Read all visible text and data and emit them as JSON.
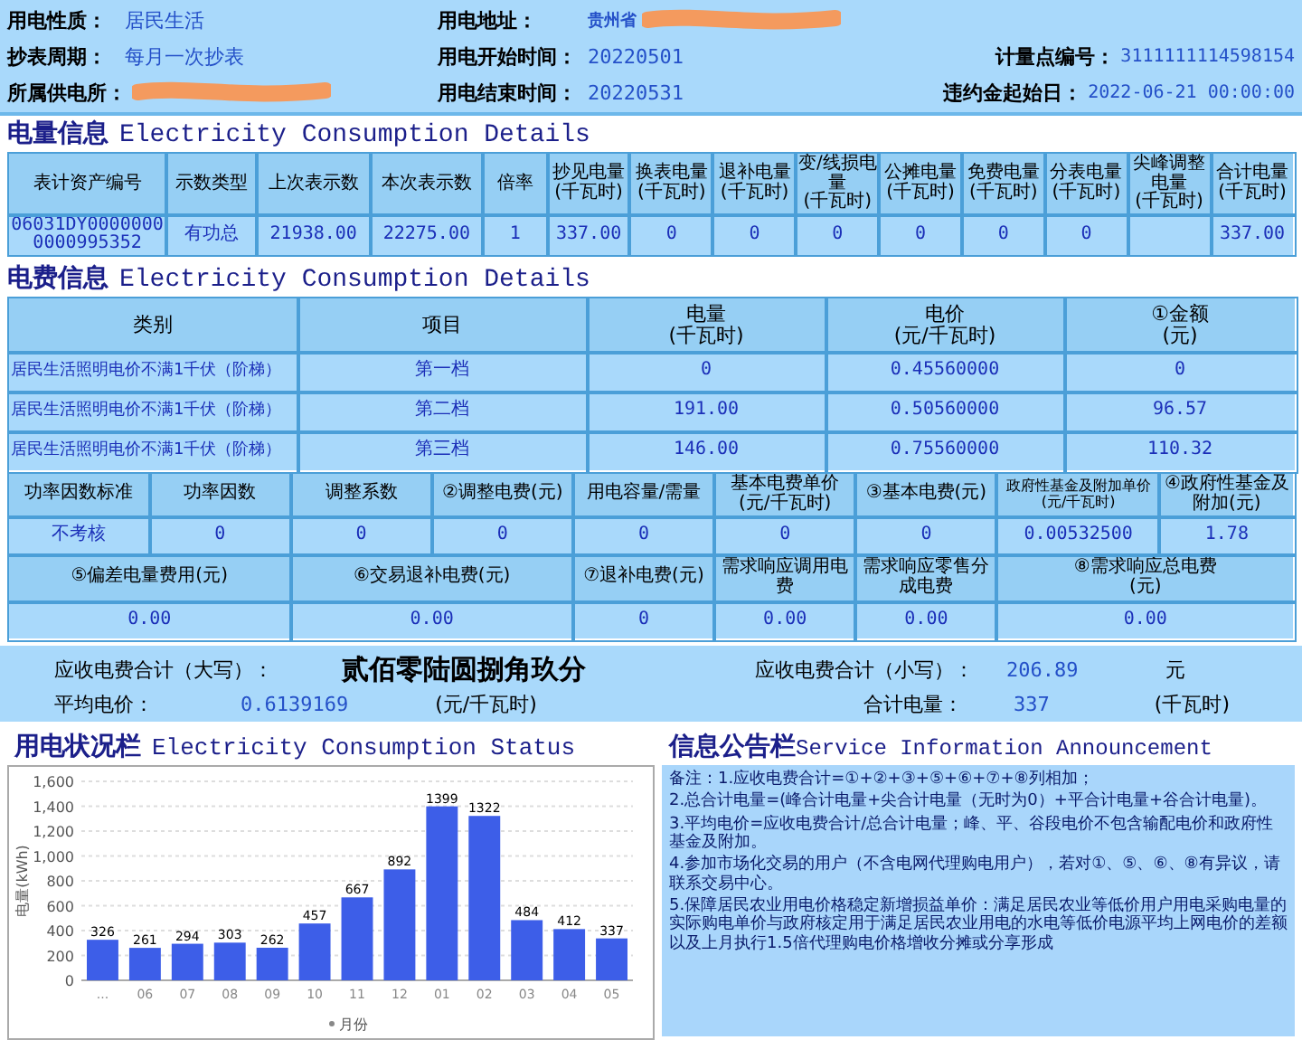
{
  "account_info": [
    [
      {
        "label": "用电性质：",
        "value": "居民生活"
      },
      {
        "label": "用电地址：",
        "value": "贵州省",
        "redacted": true
      }
    ],
    [
      {
        "label": "抄表周期：",
        "value": "每月一次抄表"
      },
      {
        "label": "用电开始时间：",
        "value": "20220501"
      },
      {
        "label": "计量点编号：",
        "value": "3111111114598154"
      }
    ],
    [
      {
        "label": "所属供电所：",
        "redacted": true
      },
      {
        "label": "用电结束时间：",
        "value": "20220531"
      },
      {
        "label": "违约金起始日：",
        "value": "2022-06-21 00:00:00"
      }
    ]
  ],
  "consumption": {
    "title": "电量信息",
    "title_en": "Electricity Consumption Details",
    "columns": [
      "表计资产编号",
      "示数类型",
      "上次表示数",
      "本次表示数",
      "倍率",
      "抄见电量\n(千瓦时)",
      "换表电量\n(千瓦时)",
      "退补电量\n(千瓦时)",
      "变/线损电量\n(千瓦时)",
      "公摊电量\n(千瓦时)",
      "免费电量\n(千瓦时)",
      "分表电量\n(千瓦时)",
      "尖峰调整电量\n(千瓦时)",
      "合计电量\n(千瓦时)"
    ],
    "rows": [
      [
        "06031DY00000000000995352",
        "有功总",
        "21938.00",
        "22275.00",
        "1",
        "337.00",
        "0",
        "0",
        "0",
        "0",
        "0",
        "0",
        "",
        "337.00"
      ]
    ]
  },
  "charges": {
    "title": "电费信息",
    "title_en": "Electricity Consumption Details",
    "columns": [
      "类别",
      "项目",
      "电量\n(千瓦时)",
      "电价\n(元/千瓦时)",
      "①金额\n(元)"
    ],
    "rows": [
      [
        "居民生活照明电价不满1千伏（阶梯）",
        "第一档",
        "0",
        "0.45560000",
        "0"
      ],
      [
        "居民生活照明电价不满1千伏（阶梯）",
        "第二档",
        "191.00",
        "0.50560000",
        "96.57"
      ],
      [
        "居民生活照明电价不满1千伏（阶梯）",
        "第三档",
        "146.00",
        "0.75560000",
        "110.32"
      ]
    ]
  },
  "adjustments": {
    "columns": [
      "功率因数标准",
      "功率因数",
      "调整系数",
      "②调整电费(元)",
      "用电容量/需量",
      "基本电费单价\n(元/千瓦时)",
      "③基本电费(元)",
      "政府性基金及附加单价\n(元/千瓦时)",
      "④政府性基金及附加(元)"
    ],
    "values": [
      "不考核",
      "0",
      "0",
      "0",
      "0",
      "0",
      "0",
      "0.00532500",
      "1.78"
    ]
  },
  "other_fees": {
    "columns": [
      "⑤偏差电量费用(元)",
      "⑥交易退补电费(元)",
      "⑦退补电费(元)",
      "需求响应调用电费",
      "需求响应零售分成电费",
      "⑧需求响应总电费\n(元)"
    ],
    "values": [
      "0.00",
      "0.00",
      "0",
      "0.00",
      "0.00",
      "0.00"
    ]
  },
  "totals": {
    "upper_label": "应收电费合计（大写）：",
    "upper_value": "贰佰零陆圆捌角玖分",
    "lower_label": "应收电费合计（小写）：",
    "lower_value": "206.89",
    "lower_unit": "元",
    "avg_label": "平均电价：",
    "avg_value": "0.6139169",
    "avg_unit": "(元/千瓦时)",
    "kwh_label": "合计电量：",
    "kwh_value": "337",
    "kwh_unit": "(千瓦时)"
  },
  "status": {
    "title": "用电状况栏",
    "title_en": "Electricity Consumption Status",
    "chart_data": {
      "type": "bar",
      "xlabel": "月份",
      "ylabel": "电量(kWh)",
      "categories": [
        "...",
        "06",
        "07",
        "08",
        "09",
        "10",
        "11",
        "12",
        "01",
        "02",
        "03",
        "04",
        "05"
      ],
      "series": [
        {
          "color": "#3d5ee8",
          "values": [
            326,
            261,
            294,
            303,
            262,
            457,
            667,
            892,
            1399,
            1322,
            484,
            412,
            337
          ]
        }
      ],
      "ylim": [
        0,
        1600
      ],
      "yticks": [
        {
          "value": 0,
          "label": "0"
        },
        {
          "value": 200,
          "label": "200"
        },
        {
          "value": 400,
          "label": "400"
        },
        {
          "value": 600,
          "label": "600"
        },
        {
          "value": 800,
          "label": "800"
        },
        {
          "value": 1000,
          "label": "1,000"
        },
        {
          "value": 1200,
          "label": "1,200"
        },
        {
          "value": 1400,
          "label": "1,400"
        },
        {
          "value": 1600,
          "label": "1,600"
        }
      ],
      "grid": true,
      "data_labels": true
    }
  },
  "announcement": {
    "title": "信息公告栏",
    "title_en": "Service Information Announcement",
    "notes": [
      "备注：1.应收电费合计=①+②+③+⑤+⑥+⑦+⑧列相加；",
      "2.总合计电量=(峰合计电量+尖合计电量（无时为0）+平合计电量+谷合计电量)。",
      "3.平均电价=应收电费合计/总合计电量；峰、平、谷段电价不包含输配电价和政府性基金及附加。",
      "4.参加市场化交易的用户（不含电网代理购电用户），若对①、⑤、⑥、⑧有异议，请联系交易中心。",
      "5.保障居民农业用电价格稳定新增损益单价：满足居民农业等低价用户用电采购电量的实际购电单价与政府核定用于满足居民农业用电的水电等低价电源平均上网电价的差额以及上月执行1.5倍代理购电价格增收分摊或分享形成"
    ]
  }
}
